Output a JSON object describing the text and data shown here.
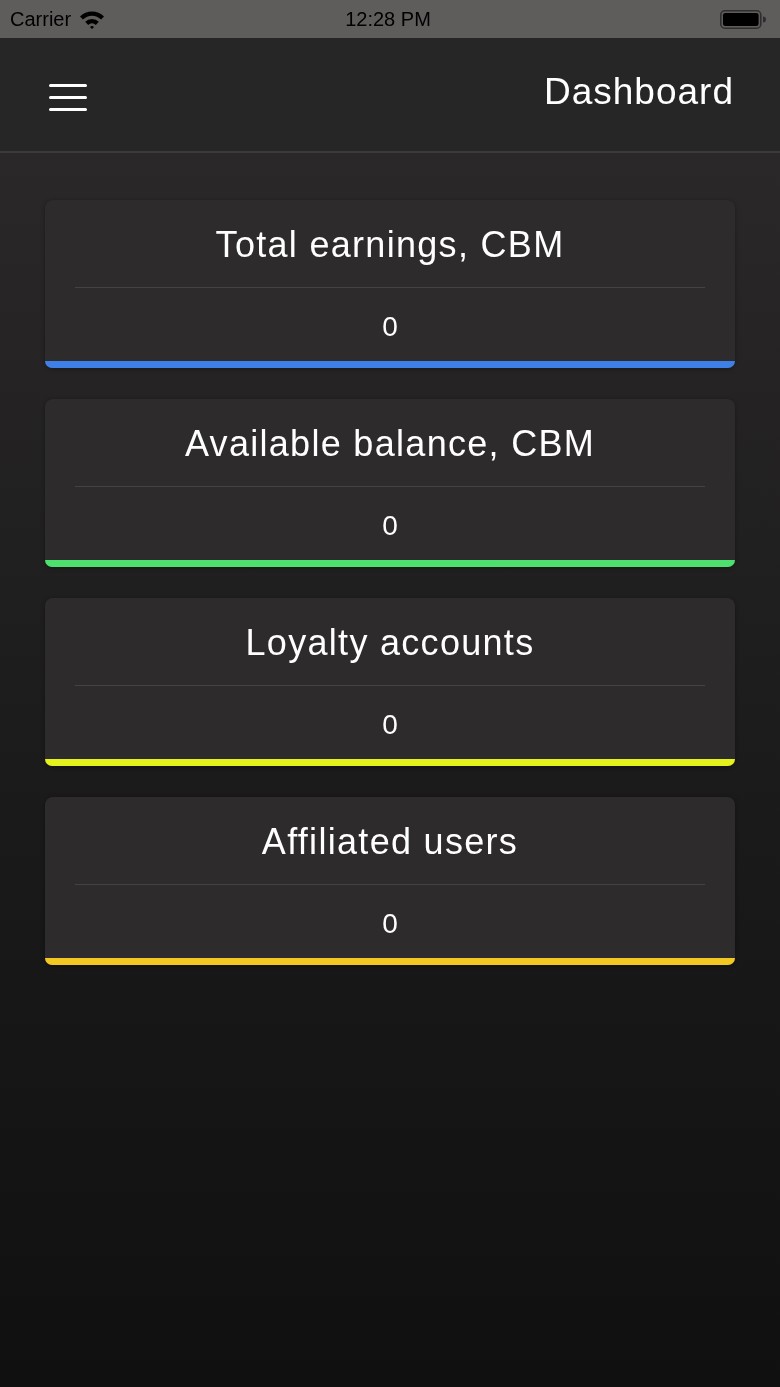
{
  "status_bar": {
    "carrier": "Carrier",
    "time": "12:28 PM"
  },
  "header": {
    "title": "Dashboard"
  },
  "cards": [
    {
      "title": "Total earnings, CBM",
      "value": "0",
      "color": "#3f80e8"
    },
    {
      "title": "Available balance, CBM",
      "value": "0",
      "color": "#4ee06e"
    },
    {
      "title": "Loyalty accounts",
      "value": "0",
      "color": "#e6f21c"
    },
    {
      "title": "Affiliated users",
      "value": "0",
      "color": "#f4c823"
    }
  ]
}
